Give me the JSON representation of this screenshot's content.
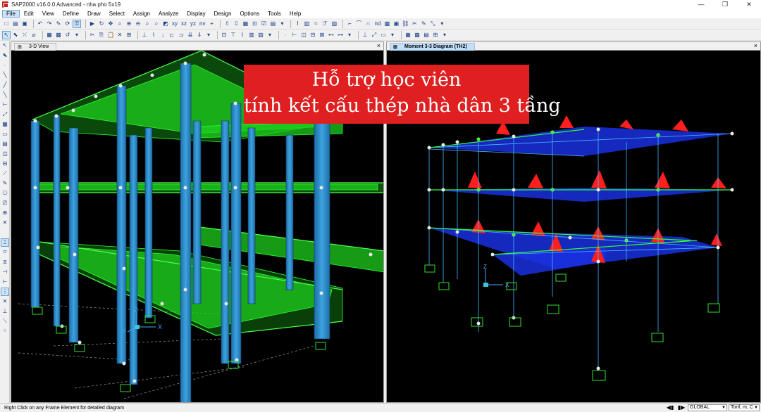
{
  "window": {
    "title": "SAP2000 v16.0.0 Advanced  - nha pho 5x19",
    "minimize": "—",
    "restore": "❐",
    "close": "✕"
  },
  "menu": [
    "File",
    "Edit",
    "View",
    "Define",
    "Draw",
    "Select",
    "Assign",
    "Analyze",
    "Display",
    "Design",
    "Options",
    "Tools",
    "Help"
  ],
  "toolbar": {
    "view_xy": "xy",
    "view_xz": "xz",
    "view_yz": "yz",
    "view_nv": "nv",
    "view_nd": "nd"
  },
  "left_pane": {
    "tab_label": "3-D View",
    "axis_x": "X",
    "axis_y": "Y",
    "axis_z": "Z"
  },
  "right_pane": {
    "tab_label": "Moment 3-3 Diagram   (TH2)",
    "axis_x": "X",
    "axis_z": "Z"
  },
  "banner": {
    "line1": "Hỗ trợ học viên",
    "line2": "tính kết cấu thép nhà dân 3 tầng"
  },
  "statusbar": {
    "text": "Right Click on any Frame Element for detailed diagram",
    "coord_system": "GLOBAL",
    "units": "Tonf, m, C"
  },
  "colors": {
    "slab_green": "#1fcf1f",
    "column_blue": "#2a86c6",
    "banner_red": "#e02020",
    "moment_red": "#ff1f1f",
    "moment_blue": "#2040ff"
  }
}
